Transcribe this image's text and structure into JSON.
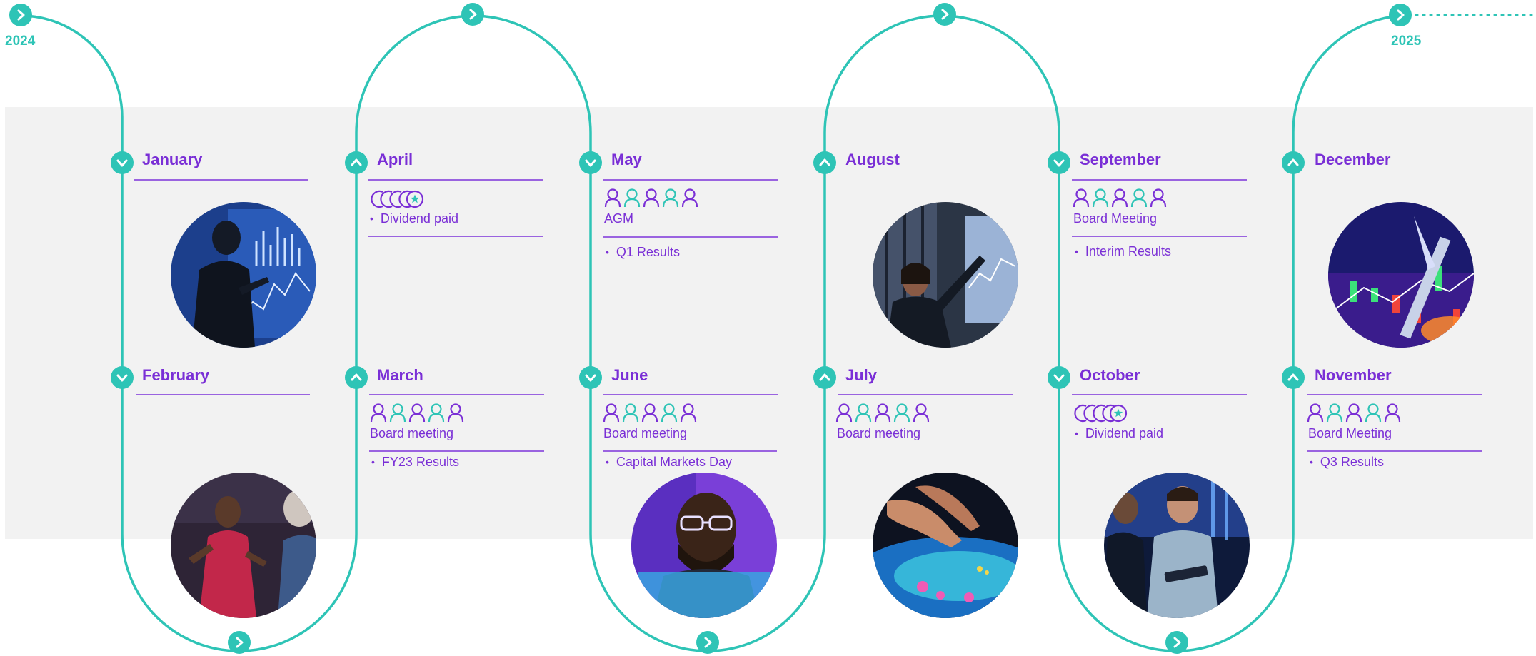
{
  "years": {
    "start": "2024",
    "end": "2025"
  },
  "colors": {
    "teal": "#2ec4b6",
    "purple": "#7a2fd6",
    "band": "#f2f2f2"
  },
  "months": {
    "january": {
      "title": "January"
    },
    "february": {
      "title": "February"
    },
    "april": {
      "title": "April",
      "bullet": "Dividend paid",
      "icon": "coins-icon"
    },
    "march": {
      "title": "March",
      "label": "Board meeting",
      "bullet": "FY23 Results",
      "icon": "people-icon"
    },
    "may": {
      "title": "May",
      "label": "AGM",
      "bullet": "Q1 Results",
      "icon": "people-icon"
    },
    "june": {
      "title": "June",
      "label": "Board meeting",
      "bullet": "Capital Markets Day",
      "icon": "people-icon"
    },
    "august": {
      "title": "August"
    },
    "july": {
      "title": "July",
      "label": "Board meeting",
      "icon": "people-icon"
    },
    "september": {
      "title": "September",
      "label": "Board Meeting",
      "bullet": "Interim Results",
      "icon": "people-icon"
    },
    "october": {
      "title": "October",
      "bullet": "Dividend paid",
      "icon": "coins-icon"
    },
    "december": {
      "title": "December"
    },
    "november": {
      "title": "November",
      "label": "Board Meeting",
      "bullet": "Q3 Results",
      "icon": "people-icon"
    }
  },
  "photos": [
    {
      "name": "january-photo",
      "subject": "analyst-with-charts"
    },
    {
      "name": "february-photo",
      "subject": "presenter"
    },
    {
      "name": "june-photo",
      "subject": "developer-at-screen"
    },
    {
      "name": "july-photo",
      "subject": "touchscreen-hand"
    },
    {
      "name": "august-photo",
      "subject": "woman-at-display"
    },
    {
      "name": "october-photo",
      "subject": "colleagues-with-tablet"
    },
    {
      "name": "december-photo",
      "subject": "stock-market-pen"
    }
  ]
}
